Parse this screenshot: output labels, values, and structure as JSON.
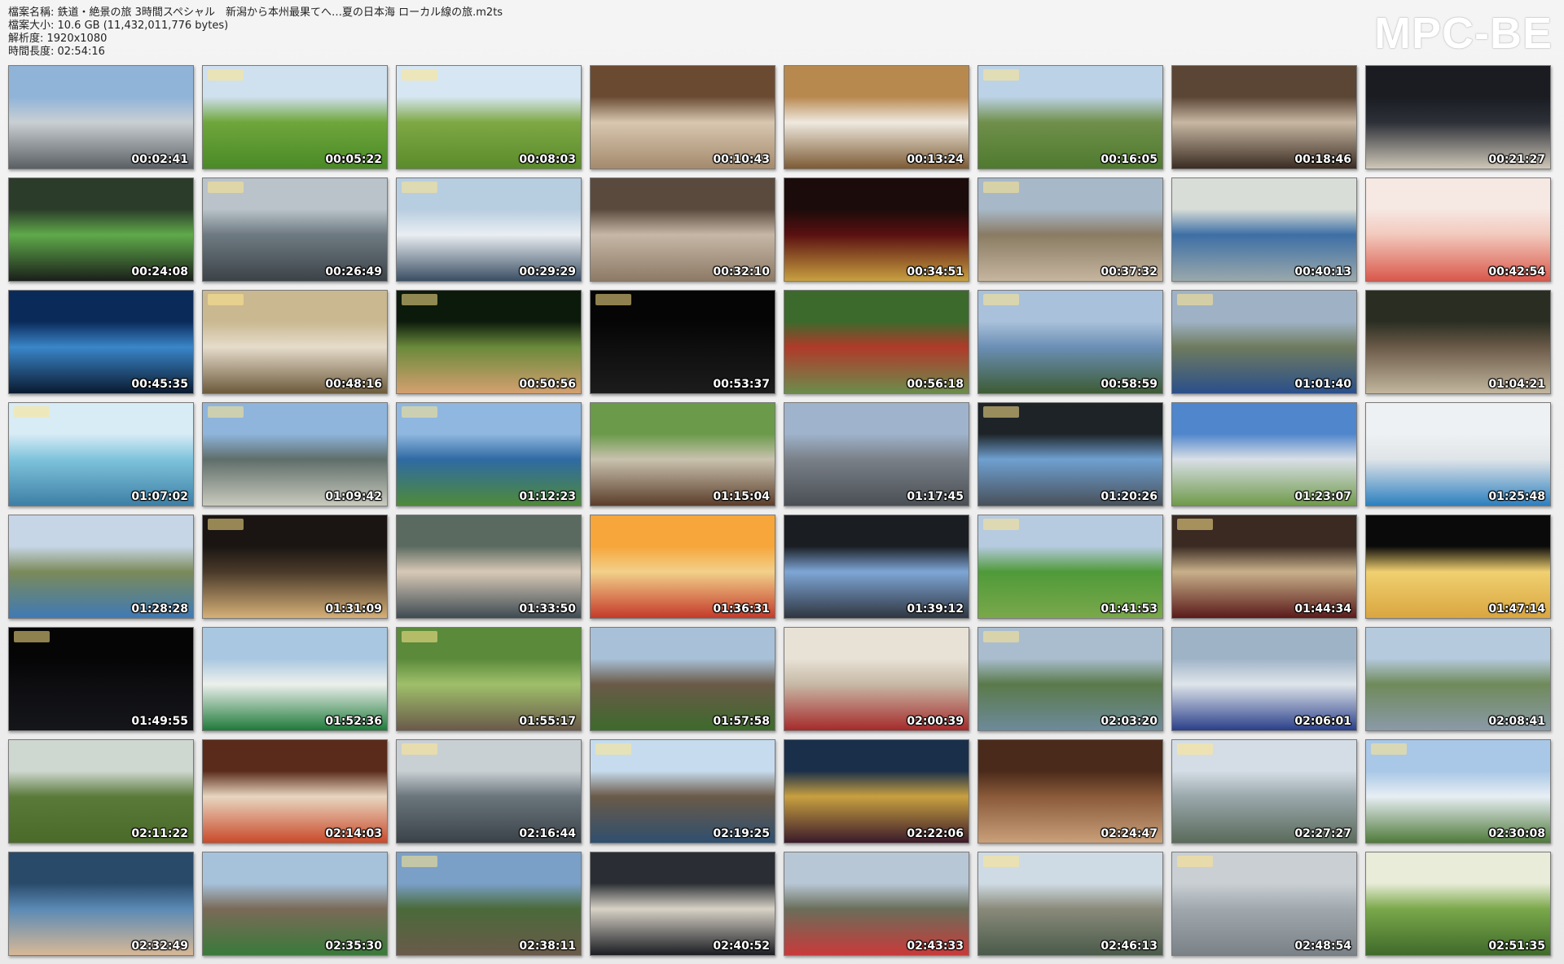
{
  "header": {
    "line1": "檔案名稱: 鉄道・絶景の旅 3時間スペシャル　新潟から本州最果てへ…夏の日本海 ローカル線の旅.m2ts",
    "line2": "檔案大小: 10.6 GB (11,432,011,776 bytes)",
    "line3": "解析度: 1920x1080",
    "line4": "時間長度: 02:54:16"
  },
  "brand": "MPC-BE",
  "thumbnails": [
    {
      "time": "00:02:41",
      "colors": [
        "#8fb4d8",
        "#c9cfd3",
        "#5a5f64"
      ],
      "logo": false
    },
    {
      "time": "00:05:22",
      "colors": [
        "#cfe0ee",
        "#6fa63c",
        "#4a8a26"
      ],
      "logo": true
    },
    {
      "time": "00:08:03",
      "colors": [
        "#d6e6f2",
        "#7ea844",
        "#5b8b2b"
      ],
      "logo": true
    },
    {
      "time": "00:10:43",
      "colors": [
        "#6a4b32",
        "#d8c7b0",
        "#a48a6d"
      ],
      "logo": false
    },
    {
      "time": "00:13:24",
      "colors": [
        "#b8894f",
        "#efe9df",
        "#7d5b34"
      ],
      "logo": false
    },
    {
      "time": "00:16:05",
      "colors": [
        "#bcd2e6",
        "#6f8f4a",
        "#4f7a2f"
      ],
      "logo": true
    },
    {
      "time": "00:18:46",
      "colors": [
        "#5b4534",
        "#c7b7a3",
        "#3a2c22"
      ],
      "logo": false
    },
    {
      "time": "00:21:27",
      "colors": [
        "#1a1c22",
        "#2d3038",
        "#cfc7b8"
      ],
      "logo": false
    },
    {
      "time": "00:24:08",
      "colors": [
        "#2b3c2a",
        "#5faa4a",
        "#1a1f1a"
      ],
      "logo": false
    },
    {
      "time": "00:26:49",
      "colors": [
        "#b9c3c9",
        "#6e7a82",
        "#3c4348"
      ],
      "logo": true
    },
    {
      "time": "00:29:29",
      "colors": [
        "#b7cde0",
        "#e9eef2",
        "#3a4e63"
      ],
      "logo": true
    },
    {
      "time": "00:32:10",
      "colors": [
        "#5a4a3e",
        "#c6b7a6",
        "#8d7a66"
      ],
      "logo": false
    },
    {
      "time": "00:34:51",
      "colors": [
        "#1b0b0b",
        "#5a1010",
        "#c8a040"
      ],
      "logo": false
    },
    {
      "time": "00:37:32",
      "colors": [
        "#a7b9c8",
        "#8a7b63",
        "#c6b6a0"
      ],
      "logo": true
    },
    {
      "time": "00:40:13",
      "colors": [
        "#d8ddd8",
        "#3d6fa5",
        "#9aa8ab"
      ],
      "logo": false
    },
    {
      "time": "00:42:54",
      "colors": [
        "#f6e8e3",
        "#f2c9bd",
        "#d9584b"
      ],
      "logo": false
    },
    {
      "time": "00:45:35",
      "colors": [
        "#0a2a5a",
        "#3a86c8",
        "#0a1a30"
      ],
      "logo": false
    },
    {
      "time": "00:48:16",
      "colors": [
        "#c9b890",
        "#e6dccb",
        "#6d5a3b"
      ],
      "logo": true
    },
    {
      "time": "00:50:56",
      "colors": [
        "#0c1a0c",
        "#6a8a3a",
        "#d4a070"
      ],
      "logo": true
    },
    {
      "time": "00:53:37",
      "colors": [
        "#050505",
        "#0e0e0e",
        "#1c1c1c"
      ],
      "logo": true
    },
    {
      "time": "00:56:18",
      "colors": [
        "#3c6a2c",
        "#b03a2a",
        "#6c8c4c"
      ],
      "logo": false
    },
    {
      "time": "00:58:59",
      "colors": [
        "#a9c1da",
        "#6a8fb5",
        "#3d5b34"
      ],
      "logo": true
    },
    {
      "time": "01:01:40",
      "colors": [
        "#9fb2c5",
        "#6f7b5e",
        "#2a4f8a"
      ],
      "logo": true
    },
    {
      "time": "01:04:21",
      "colors": [
        "#2a2e22",
        "#6b5a48",
        "#c2b69e"
      ],
      "logo": false
    },
    {
      "time": "01:07:02",
      "colors": [
        "#d8ecf5",
        "#7ec3dc",
        "#3d7fa5"
      ],
      "logo": true
    },
    {
      "time": "01:09:42",
      "colors": [
        "#8fb5dc",
        "#5f6e6a",
        "#c9cabd"
      ],
      "logo": true
    },
    {
      "time": "01:12:23",
      "colors": [
        "#8fb7e0",
        "#2f6aa3",
        "#4f8a3a"
      ],
      "logo": true
    },
    {
      "time": "01:15:04",
      "colors": [
        "#6a9a4a",
        "#c9c2ae",
        "#5a3d2a"
      ],
      "logo": false
    },
    {
      "time": "01:17:45",
      "colors": [
        "#9fb3cc",
        "#7a8088",
        "#4a4f55"
      ],
      "logo": false
    },
    {
      "time": "01:20:26",
      "colors": [
        "#1d2327",
        "#6fa0d0",
        "#48505a"
      ],
      "logo": true
    },
    {
      "time": "01:23:07",
      "colors": [
        "#4f86cc",
        "#d9dfe6",
        "#6f9a4a"
      ],
      "logo": false
    },
    {
      "time": "01:25:48",
      "colors": [
        "#eef1f3",
        "#dfe4e8",
        "#2b7fbf"
      ],
      "logo": false
    },
    {
      "time": "01:28:28",
      "colors": [
        "#c7d6e6",
        "#7b8a5a",
        "#3f7ab5"
      ],
      "logo": false
    },
    {
      "time": "01:31:09",
      "colors": [
        "#1a1512",
        "#4a3a2a",
        "#d6b078"
      ],
      "logo": true
    },
    {
      "time": "01:33:50",
      "colors": [
        "#5a6a60",
        "#d8c9b6",
        "#3d4a52"
      ],
      "logo": false
    },
    {
      "time": "01:36:31",
      "colors": [
        "#f6a63a",
        "#f2d08a",
        "#c43a2a"
      ],
      "logo": false
    },
    {
      "time": "01:39:12",
      "colors": [
        "#1a1d22",
        "#7ea6d6",
        "#2f3640"
      ],
      "logo": false
    },
    {
      "time": "01:41:53",
      "colors": [
        "#b6cbe0",
        "#4f9a3a",
        "#7aa84a"
      ],
      "logo": true
    },
    {
      "time": "01:44:34",
      "colors": [
        "#3a2a22",
        "#c8b08a",
        "#5a1a1a"
      ],
      "logo": true
    },
    {
      "time": "01:47:14",
      "colors": [
        "#0a0a0a",
        "#f0d070",
        "#d9a640"
      ],
      "logo": false
    },
    {
      "time": "01:49:55",
      "colors": [
        "#050506",
        "#0d0d10",
        "#15161a"
      ],
      "logo": true
    },
    {
      "time": "01:52:36",
      "colors": [
        "#a9c7e0",
        "#ecf0ec",
        "#1f7a3a"
      ],
      "logo": false
    },
    {
      "time": "01:55:17",
      "colors": [
        "#5a8a3a",
        "#9fbf6a",
        "#6a5a4a"
      ],
      "logo": true
    },
    {
      "time": "01:57:58",
      "colors": [
        "#a8c1d8",
        "#6a5a48",
        "#3d6a2c"
      ],
      "logo": false
    },
    {
      "time": "02:00:39",
      "colors": [
        "#e8e2d6",
        "#c7b9a6",
        "#a52a2a"
      ],
      "logo": false
    },
    {
      "time": "02:03:20",
      "colors": [
        "#a9bdcf",
        "#5a7a4a",
        "#6d8a9a"
      ],
      "logo": true
    },
    {
      "time": "02:06:01",
      "colors": [
        "#9fb3c7",
        "#dfe5ea",
        "#2a3f8a"
      ],
      "logo": false
    },
    {
      "time": "02:08:41",
      "colors": [
        "#b5cadd",
        "#6f8a5a",
        "#8a9aa8"
      ],
      "logo": false
    },
    {
      "time": "02:11:22",
      "colors": [
        "#cfd8d0",
        "#5a7a3a",
        "#4a6a2a"
      ],
      "logo": false
    },
    {
      "time": "02:14:03",
      "colors": [
        "#5a2a1a",
        "#e8d6c0",
        "#c94a2a"
      ],
      "logo": false
    },
    {
      "time": "02:16:44",
      "colors": [
        "#c9d0d4",
        "#6a767c",
        "#3a4248"
      ],
      "logo": true
    },
    {
      "time": "02:19:25",
      "colors": [
        "#c6dcee",
        "#6a5a48",
        "#2f4f6f"
      ],
      "logo": true
    },
    {
      "time": "02:22:06",
      "colors": [
        "#1a2f4a",
        "#c8a040",
        "#3a1a2a"
      ],
      "logo": false
    },
    {
      "time": "02:24:47",
      "colors": [
        "#4a2a1a",
        "#8a5a3a",
        "#c9a07a"
      ],
      "logo": false
    },
    {
      "time": "02:27:27",
      "colors": [
        "#d4dde5",
        "#9aa8ac",
        "#5a6a5a"
      ],
      "logo": true
    },
    {
      "time": "02:30:08",
      "colors": [
        "#a9c7e6",
        "#e7eef4",
        "#4f7a3a"
      ],
      "logo": true
    },
    {
      "time": "02:32:49",
      "colors": [
        "#2a4a6a",
        "#5a8ab5",
        "#d8b896"
      ],
      "logo": false
    },
    {
      "time": "02:35:30",
      "colors": [
        "#a6c2da",
        "#7a6a58",
        "#3a7a3a"
      ],
      "logo": false
    },
    {
      "time": "02:38:11",
      "colors": [
        "#7aa0c8",
        "#4a6a3a",
        "#6a5a4a"
      ],
      "logo": true
    },
    {
      "time": "02:40:52",
      "colors": [
        "#2a2e34",
        "#d8d2c6",
        "#1a1c22"
      ],
      "logo": false
    },
    {
      "time": "02:43:33",
      "colors": [
        "#b8c7d6",
        "#6a6e5a",
        "#c93a3a"
      ],
      "logo": false
    },
    {
      "time": "02:46:13",
      "colors": [
        "#cfdbe4",
        "#8a8a7a",
        "#4a5a4a"
      ],
      "logo": true
    },
    {
      "time": "02:48:54",
      "colors": [
        "#c9cfd3",
        "#a0a8ae",
        "#7a8288"
      ],
      "logo": true
    },
    {
      "time": "02:51:35",
      "colors": [
        "#e8ecd8",
        "#7aa84a",
        "#3f6a2a"
      ],
      "logo": false
    }
  ]
}
